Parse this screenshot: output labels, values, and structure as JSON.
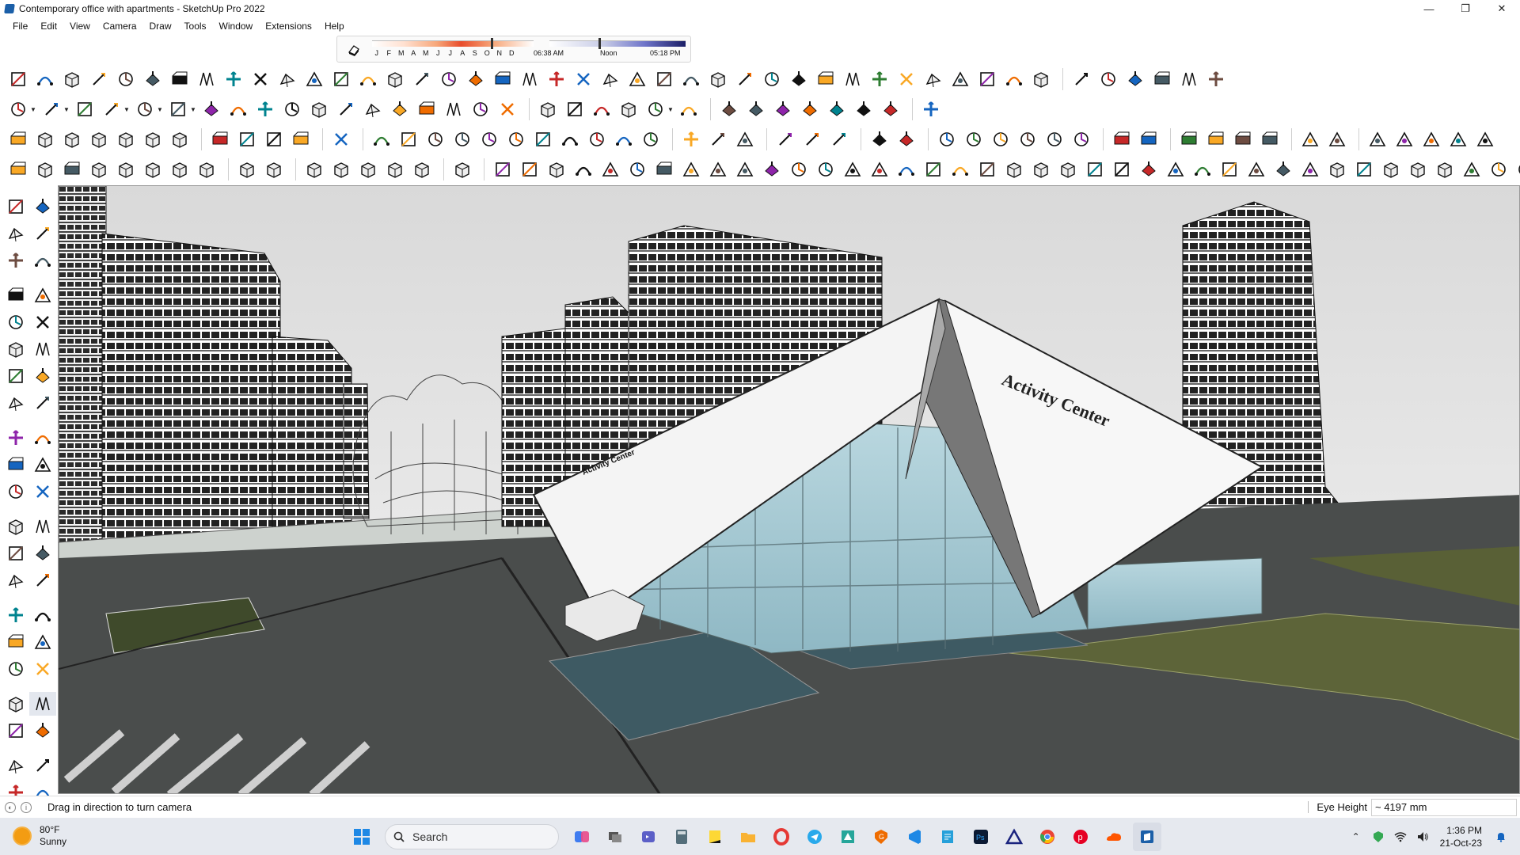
{
  "window": {
    "title": "Contemporary office with apartments - SketchUp Pro 2022",
    "controls": {
      "minimize": "—",
      "maximize": "❐",
      "close": "✕"
    }
  },
  "menu": [
    "File",
    "Edit",
    "View",
    "Camera",
    "Draw",
    "Tools",
    "Window",
    "Extensions",
    "Help"
  ],
  "shadow_bar": {
    "months": [
      "J",
      "F",
      "M",
      "A",
      "M",
      "J",
      "J",
      "A",
      "S",
      "O",
      "N",
      "D"
    ],
    "sunrise": "06:38 AM",
    "noon": "Noon",
    "sunset": "05:18 PM"
  },
  "viewport": {
    "facade_label": "Activity Center",
    "side_label": "Activity Center"
  },
  "status": {
    "message": "Drag in direction to turn camera",
    "vcb_label": "Eye Height",
    "vcb_value": "~ 4197 mm"
  },
  "taskbar": {
    "weather_temp": "80°F",
    "weather_desc": "Sunny",
    "search_placeholder": "Search",
    "time": "1:36 PM",
    "date": "21-Oct-23"
  },
  "colors": {
    "accent_red": "#d32f2f",
    "accent_blue": "#1565c0",
    "taskbar_bg": "#e6e9ef"
  }
}
